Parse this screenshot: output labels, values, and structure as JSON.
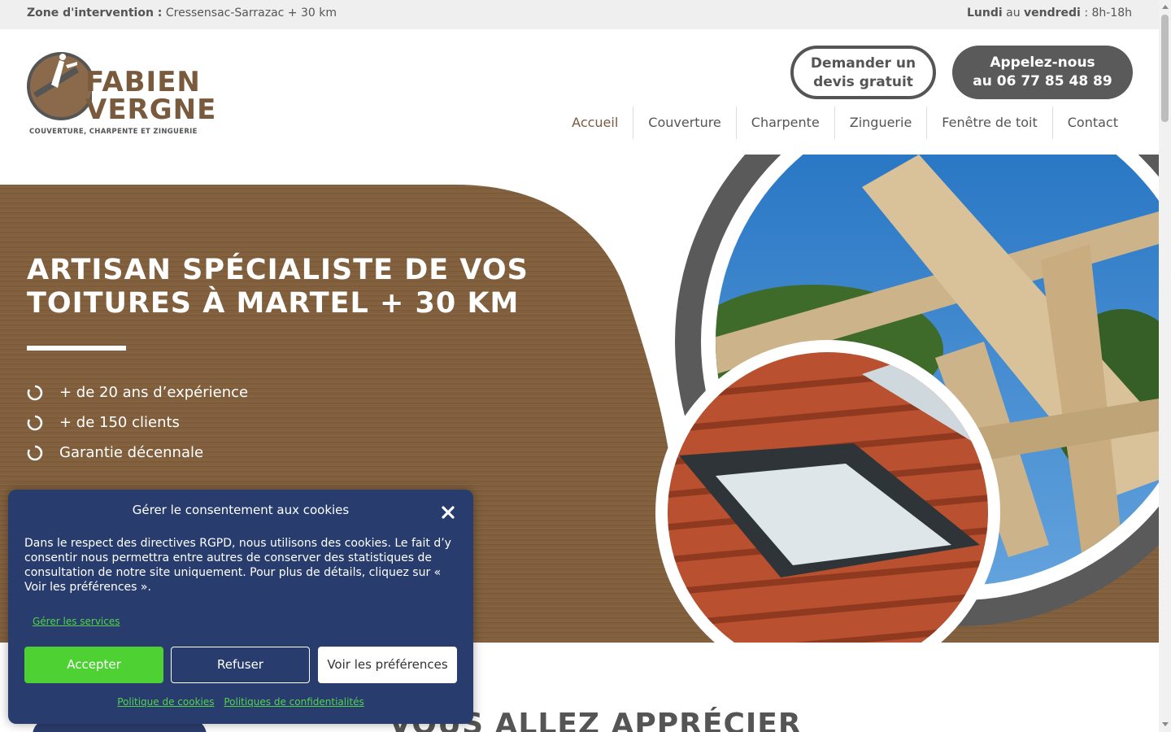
{
  "topbar": {
    "zone_label": "Zone d'intervention :",
    "zone_value": "Cressensac-Sarrazac + 30 km",
    "days_from": "Lundi",
    "days_au": "au",
    "days_to": "vendredi",
    "hours": ": 8h-18h"
  },
  "logo": {
    "line1": "FABIEN",
    "line2": "VERGNE",
    "tagline": "COUVERTURE, CHARPENTE ET ZINGUERIE"
  },
  "header_buttons": {
    "devis_line1": "Demander un",
    "devis_line2": "devis gratuit",
    "call_line1": "Appelez-nous",
    "call_line2": "au 06 77 85 48 89"
  },
  "nav": {
    "items": [
      {
        "label": "Accueil"
      },
      {
        "label": "Couverture"
      },
      {
        "label": "Charpente"
      },
      {
        "label": "Zinguerie"
      },
      {
        "label": "Fenêtre de toit"
      },
      {
        "label": "Contact"
      }
    ]
  },
  "hero": {
    "title_line1": "ARTISAN SPÉCIALISTE DE VOS",
    "title_line2": "TOITURES À MARTEL + 30 KM",
    "features": [
      {
        "text": "+ de 20 ans d’expérience"
      },
      {
        "text": "+ de 150 clients"
      },
      {
        "text": "Garantie décennale"
      }
    ]
  },
  "section": {
    "title": "VOUS ALLEZ APPRÉCIER"
  },
  "cookie": {
    "title": "Gérer le consentement aux cookies",
    "text": "Dans le respect des directives RGPD, nous utilisons des cookies. Le fait d’y consentir nous permettra entre autres de conserver des statistiques de consultation de notre site uniquement. Pour plus de détails, cliquez sur « Voir les préférences ».",
    "manage_services": "Gérer les services",
    "accept": "Accepter",
    "refuse": "Refuser",
    "preferences": "Voir les préférences",
    "cookie_policy": "Politique de cookies",
    "privacy_policy": "Politiques de confidentialités"
  },
  "colors": {
    "brand_brown": "#7a5a3c",
    "dark_grey": "#5a5a5a",
    "cookie_bg": "#283d6e",
    "accept_green": "#4dd133"
  }
}
